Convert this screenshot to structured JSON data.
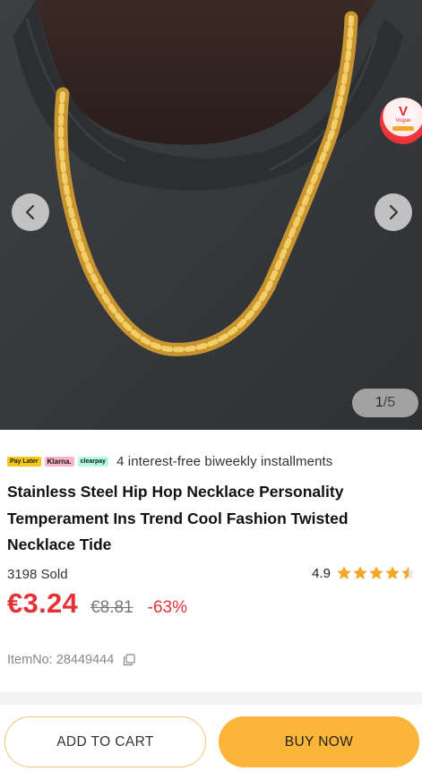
{
  "gallery": {
    "current": "1",
    "separator": "/",
    "total": "5",
    "prev_icon": "chevron-left-icon",
    "next_icon": "chevron-right-icon",
    "badge_text": "Vogue"
  },
  "payment": {
    "badges": [
      "Pay Later",
      "Klarna.",
      "clearpay"
    ],
    "text": "4 interest-free biweekly installments"
  },
  "product": {
    "title": "Stainless Steel Hip Hop Necklace Personality Temperament Ins Trend Cool Fashion Twisted Necklace Tide",
    "sold": "3198 Sold",
    "rating": "4.9",
    "stars_filled": 4.5,
    "price": "€3.24",
    "original_price": "€8.81",
    "discount": "-63%",
    "item_no": "ItemNo: 28449444"
  },
  "actions": {
    "add_to_cart": "ADD TO CART",
    "buy_now": "BUY NOW"
  },
  "colors": {
    "accent_red": "#e53236",
    "buy_button": "#fbb63a",
    "star": "#f5a623"
  }
}
